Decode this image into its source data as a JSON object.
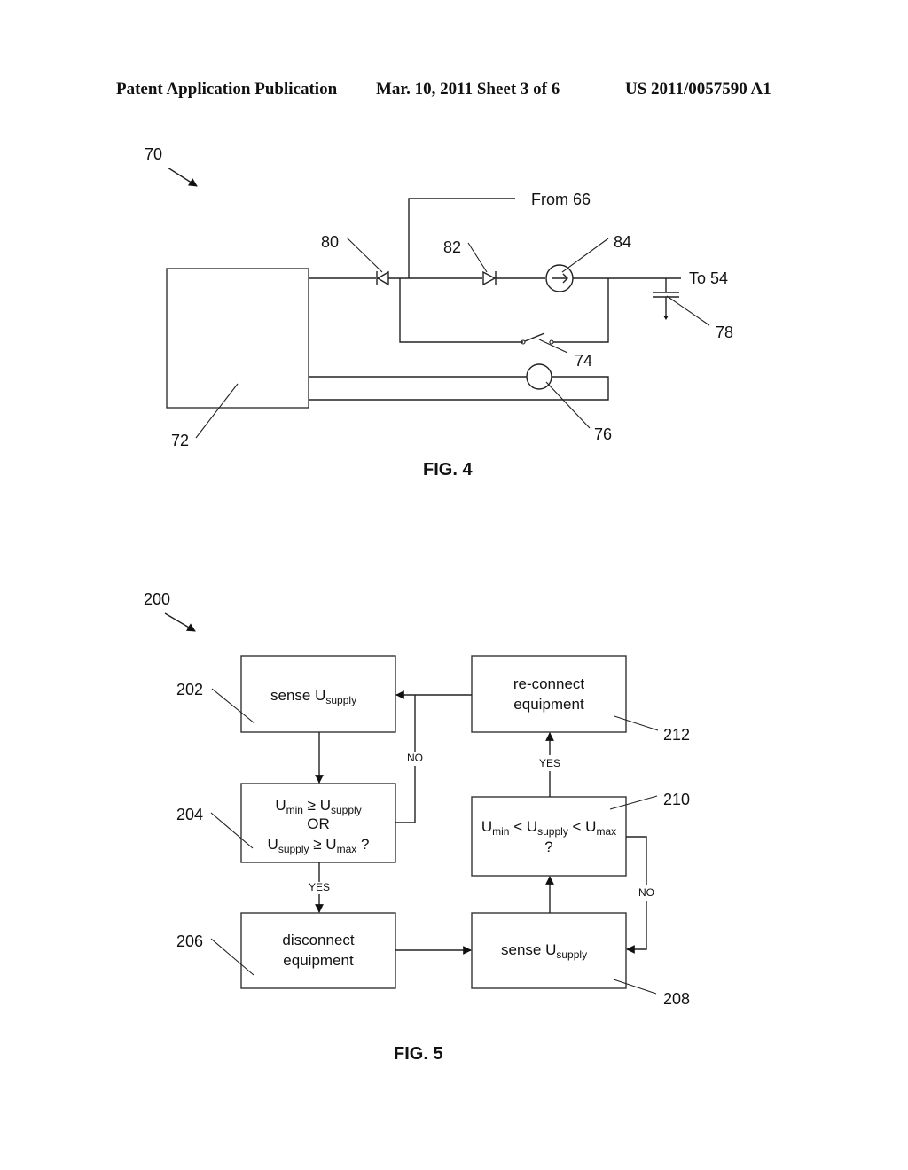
{
  "header": {
    "publication": "Patent Application Publication",
    "date_sheet": "Mar. 10, 2011  Sheet 3 of 6",
    "number": "US 2011/0057590 A1"
  },
  "fig4": {
    "ref_main": "70",
    "ref_block": "72",
    "ref_switch": "74",
    "ref_meter": "76",
    "ref_capacitor": "78",
    "ref_diode_1": "80",
    "ref_diode_2": "82",
    "ref_current_source": "84",
    "from_label": "From 66",
    "to_label": "To 54",
    "caption": "FIG. 4"
  },
  "fig5": {
    "ref_main": "200",
    "caption": "FIG. 5",
    "boxes": {
      "b202": {
        "ref": "202",
        "text": "sense U",
        "sub": "supply"
      },
      "b204": {
        "ref": "204",
        "line1_a": "U",
        "line1_a_sub": "min",
        "line1_op": " ≥ U",
        "line1_b_sub": "supply",
        "line2": "OR",
        "line3_a": "U",
        "line3_a_sub": "supply",
        "line3_op": " ≥ U",
        "line3_b_sub": "max",
        "line3_end": " ?"
      },
      "b206": {
        "ref": "206",
        "line1": "disconnect",
        "line2": "equipment"
      },
      "b208": {
        "ref": "208",
        "text": "sense U",
        "sub": "supply"
      },
      "b210": {
        "ref": "210",
        "a": "U",
        "a_sub": "min",
        "op1": " < U",
        "b_sub": "supply",
        "op2": " < U",
        "c_sub": "max",
        "line2": "?"
      },
      "b212": {
        "ref": "212",
        "line1": "re-connect",
        "line2": "equipment"
      }
    },
    "edge_labels": {
      "no_204": "NO",
      "yes_204": "YES",
      "yes_210": "YES",
      "no_210": "NO"
    }
  }
}
